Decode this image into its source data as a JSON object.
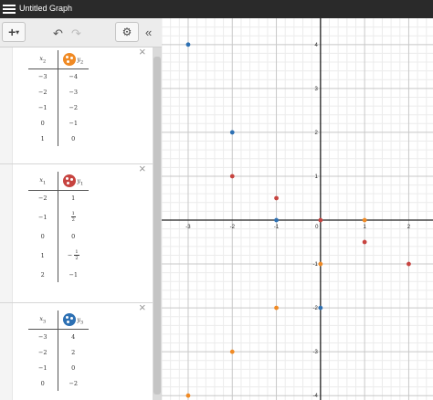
{
  "app": {
    "title": "Untitled Graph"
  },
  "toolbar": {
    "add_label": "+",
    "add_arrow": "▾",
    "undo_icon": "↶",
    "redo_icon": "↷",
    "settings_icon": "⚙",
    "collapse_icon": "«"
  },
  "colors": {
    "orange": "#f08a24",
    "red": "#c74440",
    "blue": "#2d70b3"
  },
  "expressions": [
    {
      "color": "orange",
      "header": {
        "x": "x",
        "x_sub": "2",
        "y": "y",
        "y_sub": "2"
      },
      "rows": [
        [
          "−3",
          "−4"
        ],
        [
          "−2",
          "−3"
        ],
        [
          "−1",
          "−2"
        ],
        [
          "0",
          "−1"
        ],
        [
          "1",
          "0"
        ]
      ]
    },
    {
      "color": "red",
      "header": {
        "x": "x",
        "x_sub": "1",
        "y": "y",
        "y_sub": "1"
      },
      "rows": [
        [
          "−2",
          "1"
        ],
        [
          "−1",
          "1/2"
        ],
        [
          "0",
          "0"
        ],
        [
          "1",
          "−1/2"
        ],
        [
          "2",
          "−1"
        ]
      ]
    },
    {
      "color": "blue",
      "header": {
        "x": "x",
        "x_sub": "3",
        "y": "y",
        "y_sub": "3"
      },
      "rows": [
        [
          "−3",
          "4"
        ],
        [
          "−2",
          "2"
        ],
        [
          "−1",
          "0"
        ],
        [
          "0",
          "−2"
        ]
      ]
    }
  ],
  "graph": {
    "xticks": [
      "-3",
      "-2",
      "-1",
      "0",
      "1",
      "2"
    ],
    "yticks": [
      "4",
      "3",
      "2",
      "1",
      "-1",
      "-2",
      "-3",
      "-4"
    ]
  },
  "chart_data": {
    "type": "scatter",
    "xlim": [
      -3.6,
      2.55
    ],
    "ylim": [
      -4.1,
      4.6
    ],
    "grid": true,
    "series": [
      {
        "color": "#f08a24",
        "x": [
          -3,
          -2,
          -1,
          0,
          1
        ],
        "y": [
          -4,
          -3,
          -2,
          -1,
          0
        ]
      },
      {
        "color": "#c74440",
        "x": [
          -2,
          -1,
          0,
          1,
          2
        ],
        "y": [
          1,
          0.5,
          0,
          -0.5,
          -1
        ]
      },
      {
        "color": "#2d70b3",
        "x": [
          -3,
          -2,
          -1,
          0
        ],
        "y": [
          4,
          2,
          0,
          -2
        ]
      }
    ]
  }
}
